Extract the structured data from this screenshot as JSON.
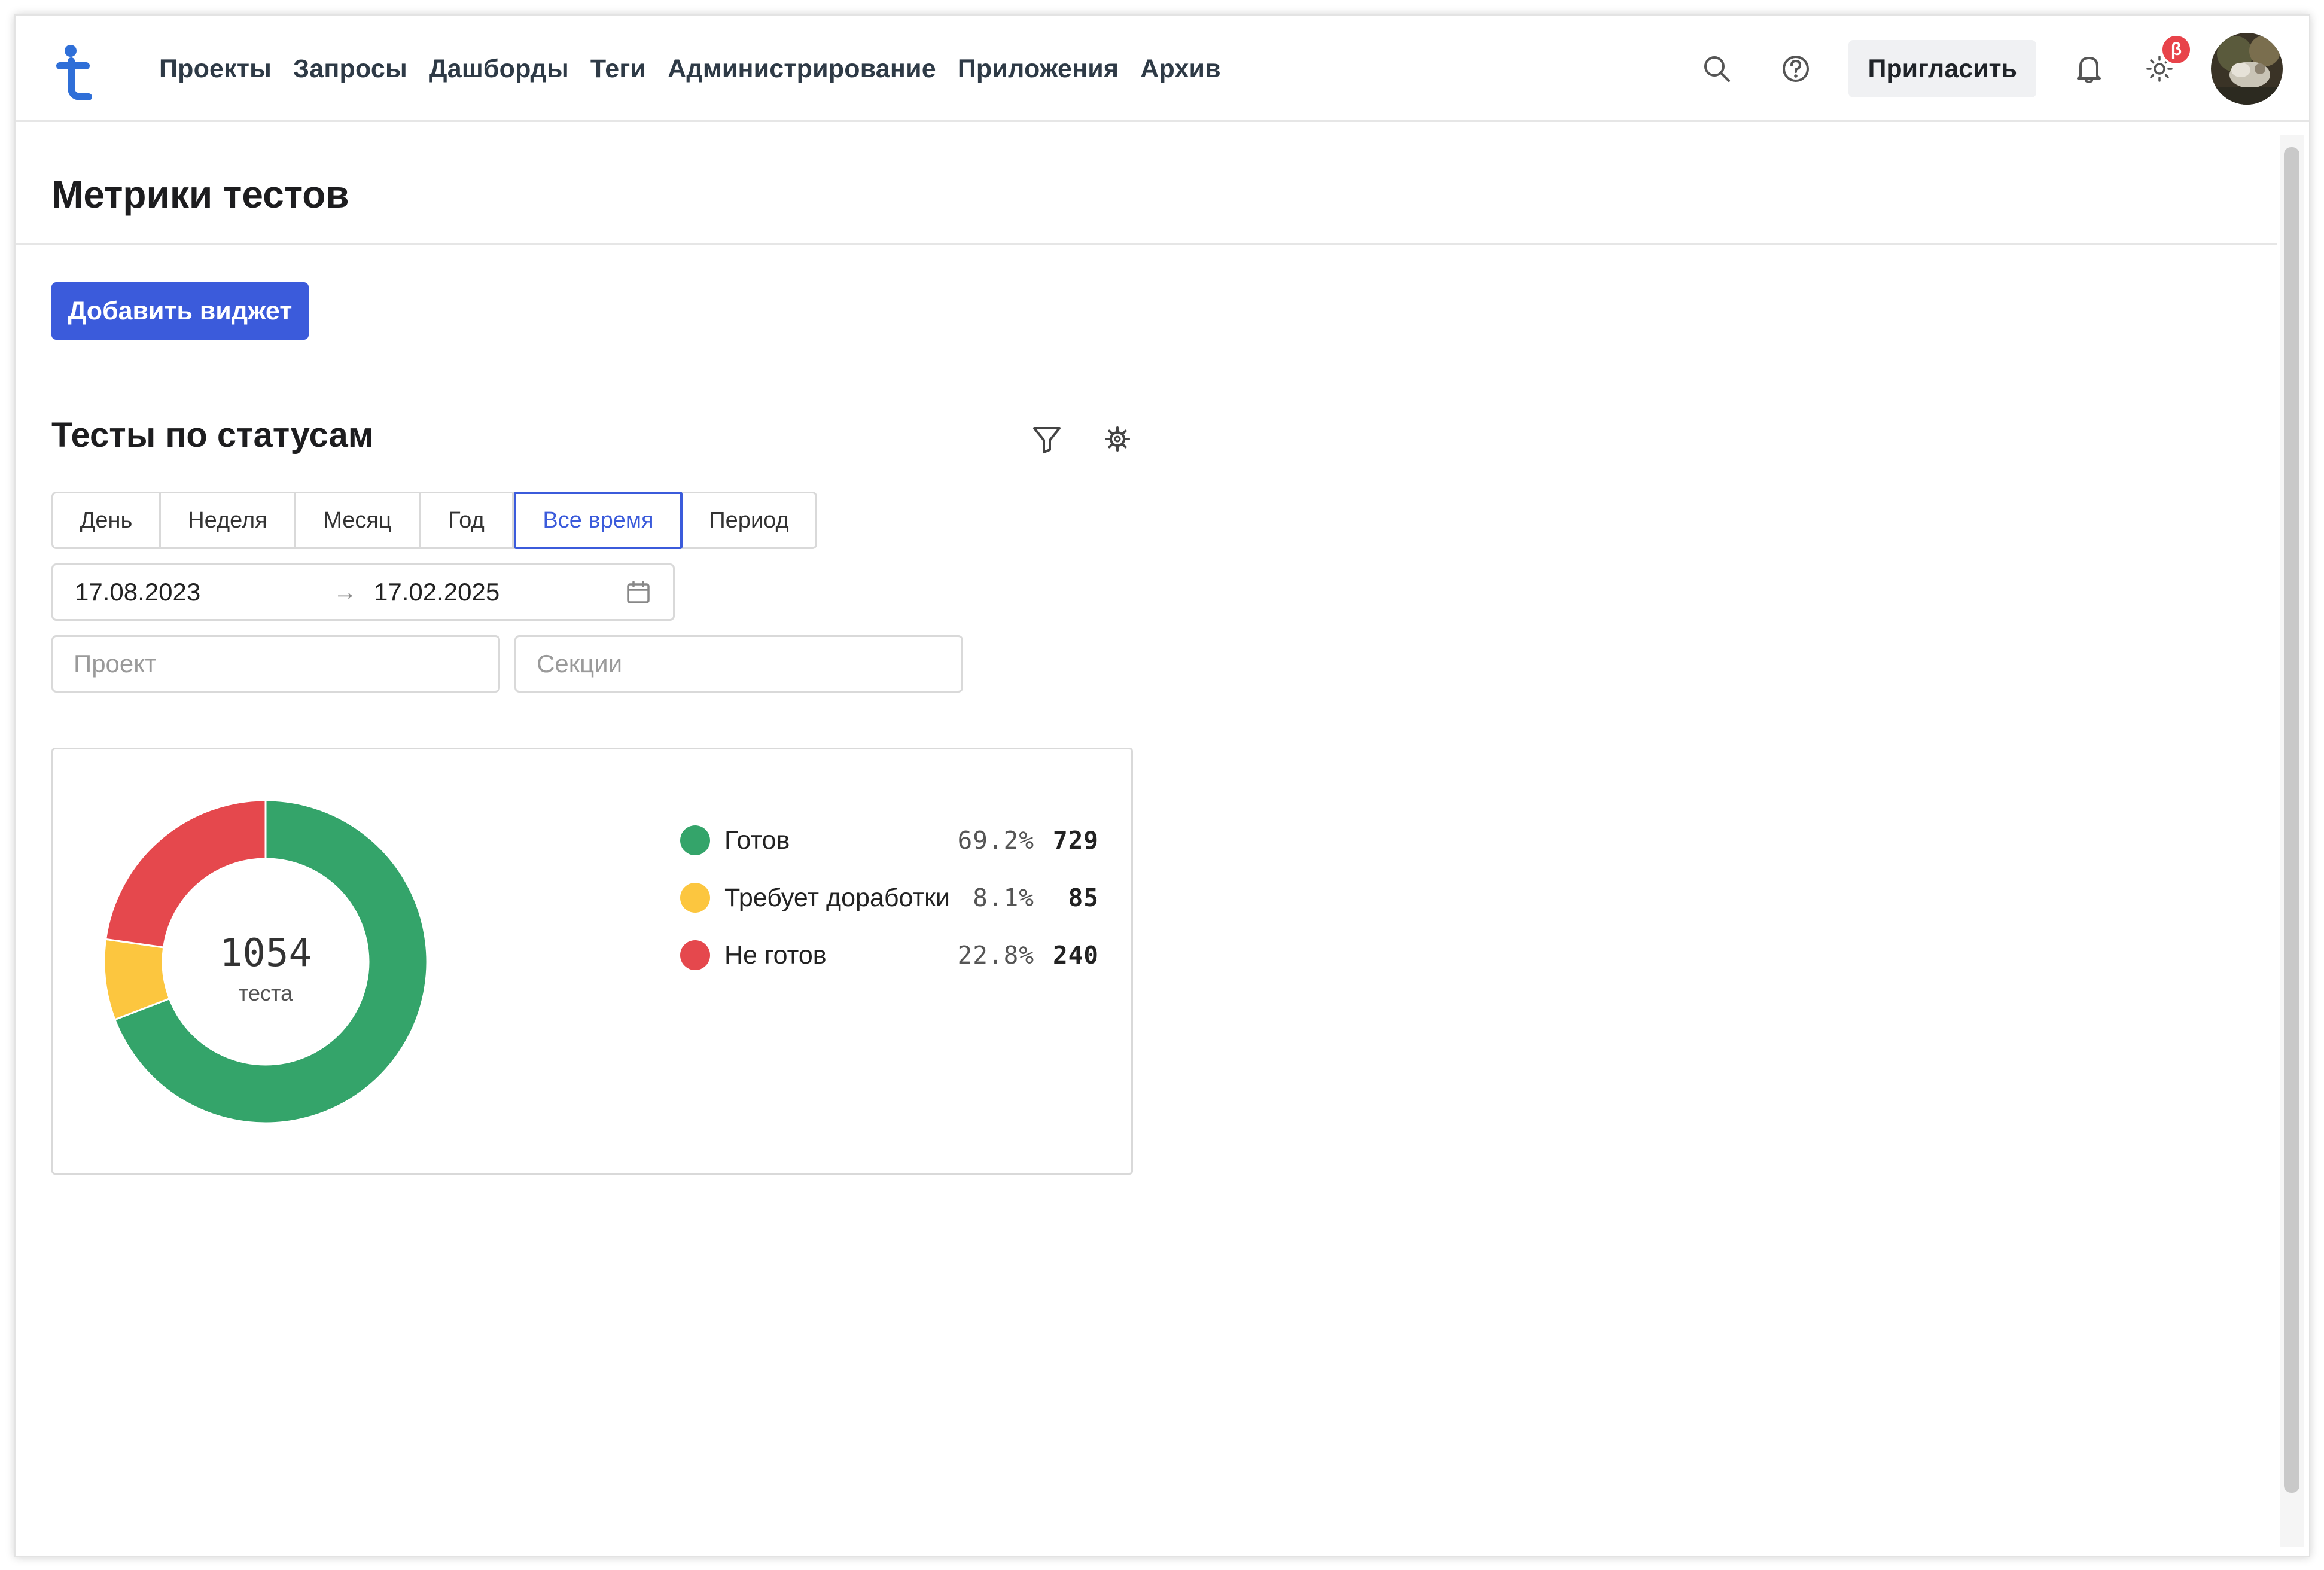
{
  "nav": {
    "items": [
      "Проекты",
      "Запросы",
      "Дашборды",
      "Теги",
      "Администрирование",
      "Приложения",
      "Архив"
    ],
    "invite_label": "Пригласить",
    "beta_badge": "β",
    "icons": [
      "search-icon",
      "help-icon",
      "bell-icon",
      "sun-icon",
      "avatar"
    ]
  },
  "page": {
    "title": "Метрики тестов",
    "add_widget_label": "Добавить виджет"
  },
  "widget": {
    "title": "Тесты по статусам",
    "periods": [
      "День",
      "Неделя",
      "Месяц",
      "Год",
      "Все время",
      "Период"
    ],
    "active_period": "Все время",
    "date_start": "17.08.2023",
    "date_arrow": "→",
    "date_end": "17.02.2025",
    "project_placeholder": "Проект",
    "sections_placeholder": "Секции",
    "total": "1054",
    "total_label": "теста",
    "legend": [
      {
        "label": "Готов",
        "percent": "69.2%",
        "count": "729",
        "color": "#34a46a"
      },
      {
        "label": "Требует доработки",
        "percent": "8.1%",
        "count": "85",
        "color": "#fcc63f"
      },
      {
        "label": "Не готов",
        "percent": "22.8%",
        "count": "240",
        "color": "#e5484d"
      }
    ]
  },
  "colors": {
    "accent": "#3b5bdb",
    "ready": "#34a46a",
    "needs_work": "#fcc63f",
    "not_ready": "#e5484d"
  },
  "chart_data": {
    "type": "pie",
    "categories": [
      "Готов",
      "Требует доработки",
      "Не готов"
    ],
    "values": [
      729,
      85,
      240
    ],
    "percent_labels": [
      "69.2%",
      "8.1%",
      "22.8%"
    ],
    "colors": [
      "#34a46a",
      "#fcc63f",
      "#e5484d"
    ],
    "legend": "right"
  }
}
